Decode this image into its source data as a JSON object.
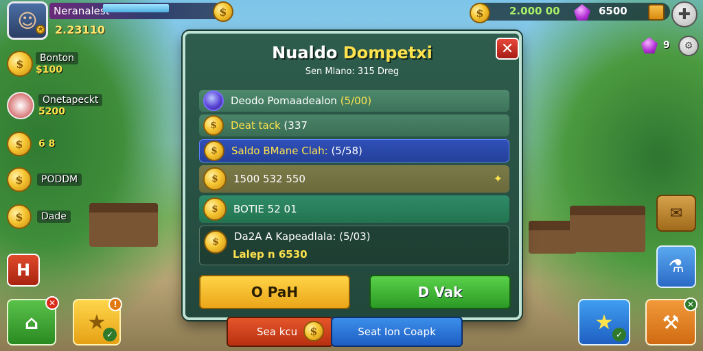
{
  "player": {
    "name": "Neranalest",
    "score": "2.23110"
  },
  "left_menu": [
    {
      "label": "Bonton",
      "value": "$100"
    },
    {
      "label": "Onetapeckt",
      "value": "5200"
    },
    {
      "label": "6 8",
      "value": ""
    },
    {
      "label": "PODDM",
      "value": ""
    },
    {
      "label": "Dade",
      "value": ""
    }
  ],
  "resources": {
    "coins": "2.000 00",
    "gems": "6500",
    "gem_count": "9"
  },
  "dialog": {
    "title_part1": "Nualdo",
    "title_part2": "Dompetxi",
    "subtitle": "Sen Mlano: 315 Dreg",
    "close_label": "✕",
    "rows": [
      {
        "label": "Deodo Pomaadealon",
        "value": "(5/00)"
      },
      {
        "label": "Deat tack",
        "value": "(337"
      },
      {
        "label": "Saldo BMane Clah:",
        "value": "(5/58)"
      },
      {
        "label": "1500 532 550",
        "value": ""
      },
      {
        "label": "BOTIE 52 01",
        "value": ""
      },
      {
        "label": "Da2A A Kapeadlala:",
        "value": "(5/03)",
        "line2": "Lalep n 6530"
      }
    ],
    "btn_left": "O PaH",
    "btn_right": "D Vak"
  },
  "bottom": {
    "left_label": "Sea kcu",
    "right_label": "Seat Ion Coapk"
  },
  "side_left": {
    "h_label": "H"
  },
  "colors": {
    "accent": "#ffe34d",
    "dialog_bg": "#2e5d4d",
    "highlight_row": "#3050b8"
  }
}
